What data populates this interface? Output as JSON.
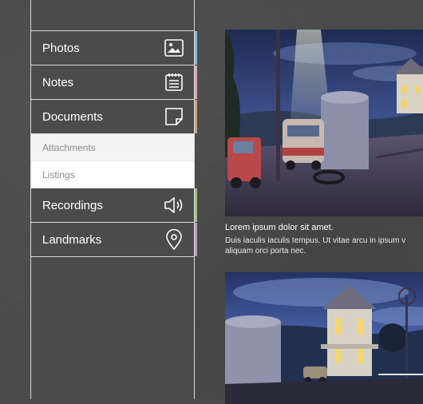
{
  "menu": {
    "items": [
      {
        "label": "Photos",
        "icon": "image-icon",
        "accent": "#8fb8d6"
      },
      {
        "label": "Notes",
        "icon": "notepad-icon",
        "accent": "#d9a8a8"
      },
      {
        "label": "Documents",
        "icon": "document-icon",
        "accent": "#c9a585"
      }
    ],
    "sub_items": [
      {
        "label": "Attachments"
      },
      {
        "label": "Listings"
      }
    ],
    "items_after": [
      {
        "label": "Recordings",
        "icon": "speaker-icon",
        "accent": "#9cc48d"
      },
      {
        "label": "Landmarks",
        "icon": "location-pin-icon",
        "accent": "#b79ac4"
      }
    ]
  },
  "content": {
    "cards": [
      {
        "title": "Lorem ipsum dolor sit amet.",
        "text": "Duis iaculis iaculis tempus. Ut vitae arcu in ipsum v aliquam orci porta nec."
      }
    ]
  }
}
